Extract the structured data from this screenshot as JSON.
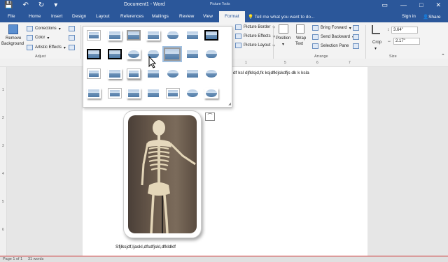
{
  "titlebar": {
    "title": "Document1 - Word",
    "tools_label": "Picture Tools",
    "qat": {
      "save": "💾",
      "undo": "↶",
      "redo": "↻",
      "more": "▾"
    },
    "win": {
      "restore": "▭",
      "minimize": "—",
      "maximize": "□",
      "close": "✕"
    }
  },
  "tabs": {
    "file": "File",
    "home": "Home",
    "insert": "Insert",
    "design": "Design",
    "layout": "Layout",
    "references": "References",
    "mailings": "Mailings",
    "review": "Review",
    "view": "View",
    "format": "Format"
  },
  "tellme": "Tell me what you want to do...",
  "signin": "Sign in",
  "share": "Share",
  "ribbon": {
    "remove_bg_1": "Remove",
    "remove_bg_2": "Background",
    "corrections": "Corrections",
    "color": "Color",
    "artistic": "Artistic Effects",
    "adjust_label": "Adjust",
    "picture_border": "Picture Border",
    "picture_effects": "Picture Effects",
    "picture_layout": "Picture Layout",
    "position": "Position",
    "wrap_1": "Wrap",
    "wrap_2": "Text",
    "bring_forward": "Bring Forward",
    "send_backward": "Send Backward",
    "selection_pane": "Selection Pane",
    "arrange_label": "Arrange",
    "crop": "Crop",
    "height": "3.64\"",
    "width": "2.17\"",
    "size_label": "Size"
  },
  "ruler": {
    "m1": "1",
    "m5": "5",
    "m6": "6",
    "m7": "7"
  },
  "vruler": {
    "m1": "1",
    "m2": "2",
    "m3": "3",
    "m4": "4",
    "m5": "5",
    "m6": "6"
  },
  "document": {
    "line1": "df ksl djfklsjd,fk ksjdfkljskdfjs dk k ksla",
    "line2": "Sfjlksjdf,ljaskl,dfsdfjskl,dfkldklf"
  },
  "status": {
    "page": "Page 1 of 1",
    "words": "31 words"
  },
  "colors": {
    "accent": "#2b579a",
    "ribbon_bg": "#f3f3f3",
    "canvas": "#e6e6e6"
  }
}
